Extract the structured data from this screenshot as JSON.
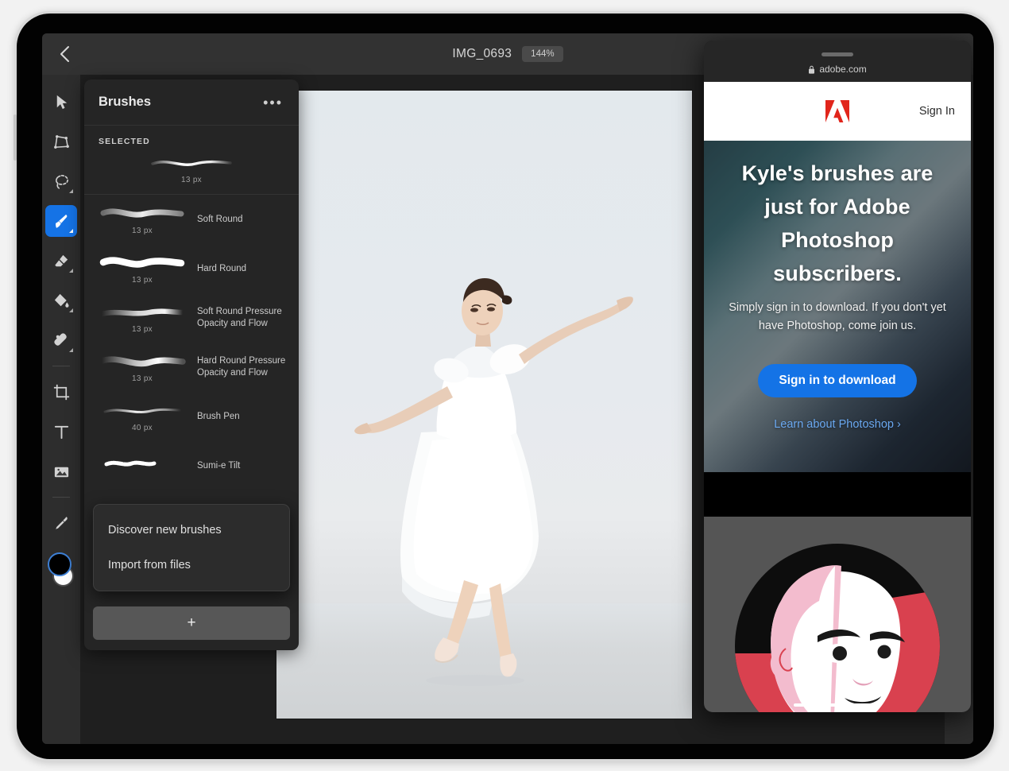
{
  "app": {
    "topbar": {
      "back_icon": "chevron-left-icon",
      "doc_title": "IMG_0693",
      "zoom_level": "144%",
      "right_icons": [
        "cloud-icon",
        "undo-icon",
        "magic-wand-icon",
        "help-icon",
        "share-icon"
      ]
    },
    "tools": [
      {
        "name": "move-tool",
        "icon": "cursor-arrow-icon",
        "active": false,
        "has_submenu": false
      },
      {
        "name": "transform-tool",
        "icon": "transform-icon",
        "active": false,
        "has_submenu": false
      },
      {
        "name": "lasso-tool",
        "icon": "lasso-icon",
        "active": false,
        "has_submenu": true
      },
      {
        "name": "brush-tool",
        "icon": "paintbrush-icon",
        "active": true,
        "has_submenu": true
      },
      {
        "name": "eraser-tool",
        "icon": "eraser-icon",
        "active": false,
        "has_submenu": true
      },
      {
        "name": "fill-tool",
        "icon": "paint-bucket-icon",
        "active": false,
        "has_submenu": true
      },
      {
        "name": "heal-tool",
        "icon": "spot-heal-icon",
        "active": false,
        "has_submenu": true
      },
      {
        "name": "crop-tool",
        "icon": "crop-icon",
        "active": false,
        "has_submenu": false
      },
      {
        "name": "type-tool",
        "icon": "text-type-icon",
        "active": false,
        "has_submenu": false
      },
      {
        "name": "place-image-tool",
        "icon": "place-image-icon",
        "active": false,
        "has_submenu": false
      },
      {
        "name": "eyedropper-tool",
        "icon": "eyedropper-icon",
        "active": false,
        "has_submenu": false
      }
    ],
    "color_swatch": {
      "foreground": "#000000",
      "background": "#ffffff",
      "ring_color": "#3d7fd4"
    },
    "right_rail_icons": [
      "layers-icon",
      "adjustments-icon",
      "masks-icon",
      "properties-icon",
      "chevron-right-icon",
      "panel-icon",
      "bracket-icon",
      "lightning-icon"
    ]
  },
  "brushes_panel": {
    "title": "Brushes",
    "menu_icon": "more-options-icon",
    "menu_label": "•••",
    "section_label": "SELECTED",
    "selected_brush": {
      "name": "",
      "size": "13 px",
      "style": "soft"
    },
    "brushes": [
      {
        "name": "Soft Round",
        "size": "13 px",
        "style": "soft"
      },
      {
        "name": "Hard Round",
        "size": "13 px",
        "style": "hard"
      },
      {
        "name": "Soft Round Pressure Opacity and Flow",
        "size": "13 px",
        "style": "soft-pressure"
      },
      {
        "name": "Hard Round Pressure Opacity and Flow",
        "size": "13 px",
        "style": "hard-pressure"
      },
      {
        "name": "Brush Pen",
        "size": "40 px",
        "style": "pen"
      },
      {
        "name": "Sumi-e Tilt",
        "size": "",
        "style": "rough"
      }
    ],
    "context_menu": {
      "items": [
        {
          "label": "Discover new brushes"
        },
        {
          "label": "Import from files"
        }
      ]
    },
    "add_button": {
      "label": "+",
      "icon": "plus-icon"
    }
  },
  "browser_overlay": {
    "drag_handle": "drag-handle",
    "lock_icon": "lock-icon",
    "url": "adobe.com",
    "site": {
      "logo": "adobe-logo-icon",
      "signin_label": "Sign In",
      "hero_title": "Kyle's brushes are just for Adobe Photoshop subscribers.",
      "hero_subtitle": "Simply sign in to download. If you don't yet have Photoshop, come join us.",
      "cta_label": "Sign in to download",
      "learn_link_label": "Learn about Photoshop ›",
      "avatar": "user-avatar-illustration"
    }
  },
  "colors": {
    "accent_blue": "#1473e6",
    "tool_active_blue": "#1573e6",
    "adobe_red": "#e1251b",
    "panel_bg": "#252525",
    "app_bg": "#1f1f1f",
    "chrome_bg": "#323232",
    "link_blue": "#6aa8f0"
  }
}
